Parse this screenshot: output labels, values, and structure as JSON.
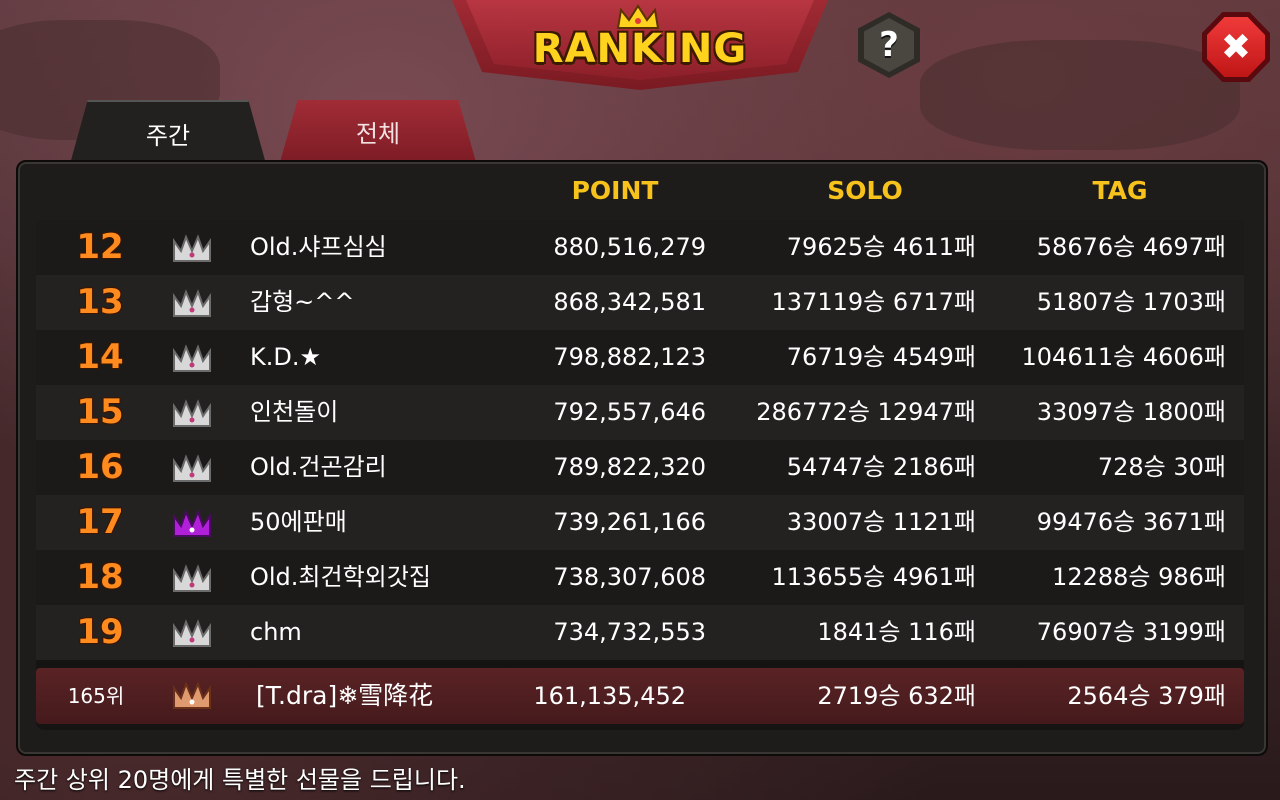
{
  "header": {
    "title": "RANKING",
    "help_label": "?",
    "close_label": "✖"
  },
  "tabs": [
    {
      "label": "주간",
      "active": true
    },
    {
      "label": "전체",
      "active": false
    }
  ],
  "columns": {
    "point": "POINT",
    "solo": "SOLO",
    "tag": "TAG"
  },
  "rows": [
    {
      "rank": "12",
      "crown": "silver",
      "name": "Old.샤프심심",
      "point": "880,516,279",
      "solo": "79625승 4611패",
      "tag": "58676승 4697패"
    },
    {
      "rank": "13",
      "crown": "silver",
      "name": "갑형~^^",
      "point": "868,342,581",
      "solo": "137119승 6717패",
      "tag": "51807승 1703패"
    },
    {
      "rank": "14",
      "crown": "silver",
      "name": "K.D.★",
      "point": "798,882,123",
      "solo": "76719승 4549패",
      "tag": "104611승 4606패"
    },
    {
      "rank": "15",
      "crown": "silver",
      "name": "인천돌이",
      "point": "792,557,646",
      "solo": "286772승 12947패",
      "tag": "33097승 1800패"
    },
    {
      "rank": "16",
      "crown": "silver",
      "name": "Old.건곤감리",
      "point": "789,822,320",
      "solo": "54747승 2186패",
      "tag": "728승 30패"
    },
    {
      "rank": "17",
      "crown": "purple",
      "name": "50에판매",
      "point": "739,261,166",
      "solo": "33007승 1121패",
      "tag": "99476승 3671패"
    },
    {
      "rank": "18",
      "crown": "silver",
      "name": "Old.최건학외갓집",
      "point": "738,307,608",
      "solo": "113655승 4961패",
      "tag": "12288승 986패"
    },
    {
      "rank": "19",
      "crown": "silver",
      "name": "chm",
      "point": "734,732,553",
      "solo": "1841승 116패",
      "tag": "76907승 3199패"
    }
  ],
  "me": {
    "rank": "165위",
    "crown": "bronze",
    "name": "[T.dra]❄雪降花",
    "point": "161,135,452",
    "solo": "2719승 632패",
    "tag": "2564승 379패"
  },
  "footer": "주간 상위 20명에게 특별한 선물을 드립니다.",
  "colors": {
    "accent_gold": "#f6c21b",
    "rank_orange": "#ff8a1e",
    "tab_red": "#a12c36",
    "crown_silver": "#d8d8d8",
    "crown_purple": "#b020d8",
    "crown_bronze": "#e09a70"
  }
}
